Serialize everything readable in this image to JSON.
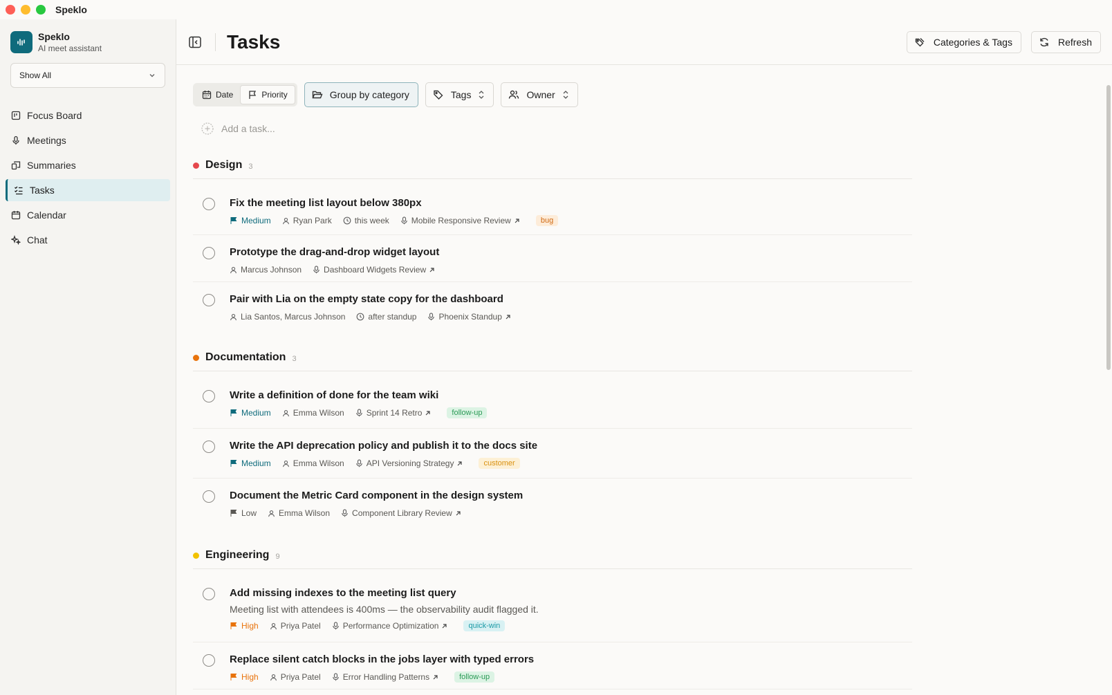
{
  "window": {
    "title": "Speklo"
  },
  "brand": {
    "name": "Speklo",
    "subtitle": "AI meet assistant"
  },
  "filter": {
    "value": "Show All"
  },
  "nav": [
    {
      "label": "Focus Board",
      "icon": "board-icon"
    },
    {
      "label": "Meetings",
      "icon": "mic-icon"
    },
    {
      "label": "Summaries",
      "icon": "summaries-icon"
    },
    {
      "label": "Tasks",
      "icon": "tasks-icon",
      "active": true
    },
    {
      "label": "Calendar",
      "icon": "calendar-icon"
    },
    {
      "label": "Chat",
      "icon": "sparkle-icon"
    }
  ],
  "header": {
    "title": "Tasks",
    "categories_label": "Categories & Tags",
    "refresh_label": "Refresh"
  },
  "toolbar": {
    "sort_date": "Date",
    "sort_priority": "Priority",
    "group_label": "Group by category",
    "tags_label": "Tags",
    "owner_label": "Owner"
  },
  "add_task": {
    "placeholder": "Add a task..."
  },
  "colors": {
    "accent": "#0f6b7c",
    "design": "#e5484d",
    "documentation": "#e8730c",
    "engineering": "#f2c200"
  },
  "groups": [
    {
      "name": "Design",
      "count": "3",
      "tasks": [
        {
          "title": "Fix the meeting list layout below 380px",
          "priority": "Medium",
          "owner": "Ryan Park",
          "due": "this week",
          "meeting": "Mobile Responsive Review",
          "tag": "bug"
        },
        {
          "title": "Prototype the drag-and-drop widget layout",
          "owner": "Marcus Johnson",
          "meeting": "Dashboard Widgets Review"
        },
        {
          "title": "Pair with Lia on the empty state copy for the dashboard",
          "owner": "Lia Santos, Marcus Johnson",
          "due": "after standup",
          "meeting": "Phoenix Standup"
        }
      ]
    },
    {
      "name": "Documentation",
      "count": "3",
      "tasks": [
        {
          "title": "Write a definition of done for the team wiki",
          "priority": "Medium",
          "owner": "Emma Wilson",
          "meeting": "Sprint 14 Retro",
          "tag": "follow-up"
        },
        {
          "title": "Write the API deprecation policy and publish it to the docs site",
          "priority": "Medium",
          "owner": "Emma Wilson",
          "meeting": "API Versioning Strategy",
          "tag": "customer"
        },
        {
          "title": "Document the Metric Card component in the design system",
          "priority": "Low",
          "owner": "Emma Wilson",
          "meeting": "Component Library Review"
        }
      ]
    },
    {
      "name": "Engineering",
      "count": "9",
      "tasks": [
        {
          "title": "Add missing indexes to the meeting list query",
          "description": "Meeting list with attendees is 400ms — the observability audit flagged it.",
          "priority": "High",
          "owner": "Priya Patel",
          "meeting": "Performance Optimization",
          "tag": "quick-win"
        },
        {
          "title": "Replace silent catch blocks in the jobs layer with typed errors",
          "priority": "High",
          "owner": "Priya Patel",
          "meeting": "Error Handling Patterns",
          "tag": "follow-up"
        }
      ]
    }
  ]
}
